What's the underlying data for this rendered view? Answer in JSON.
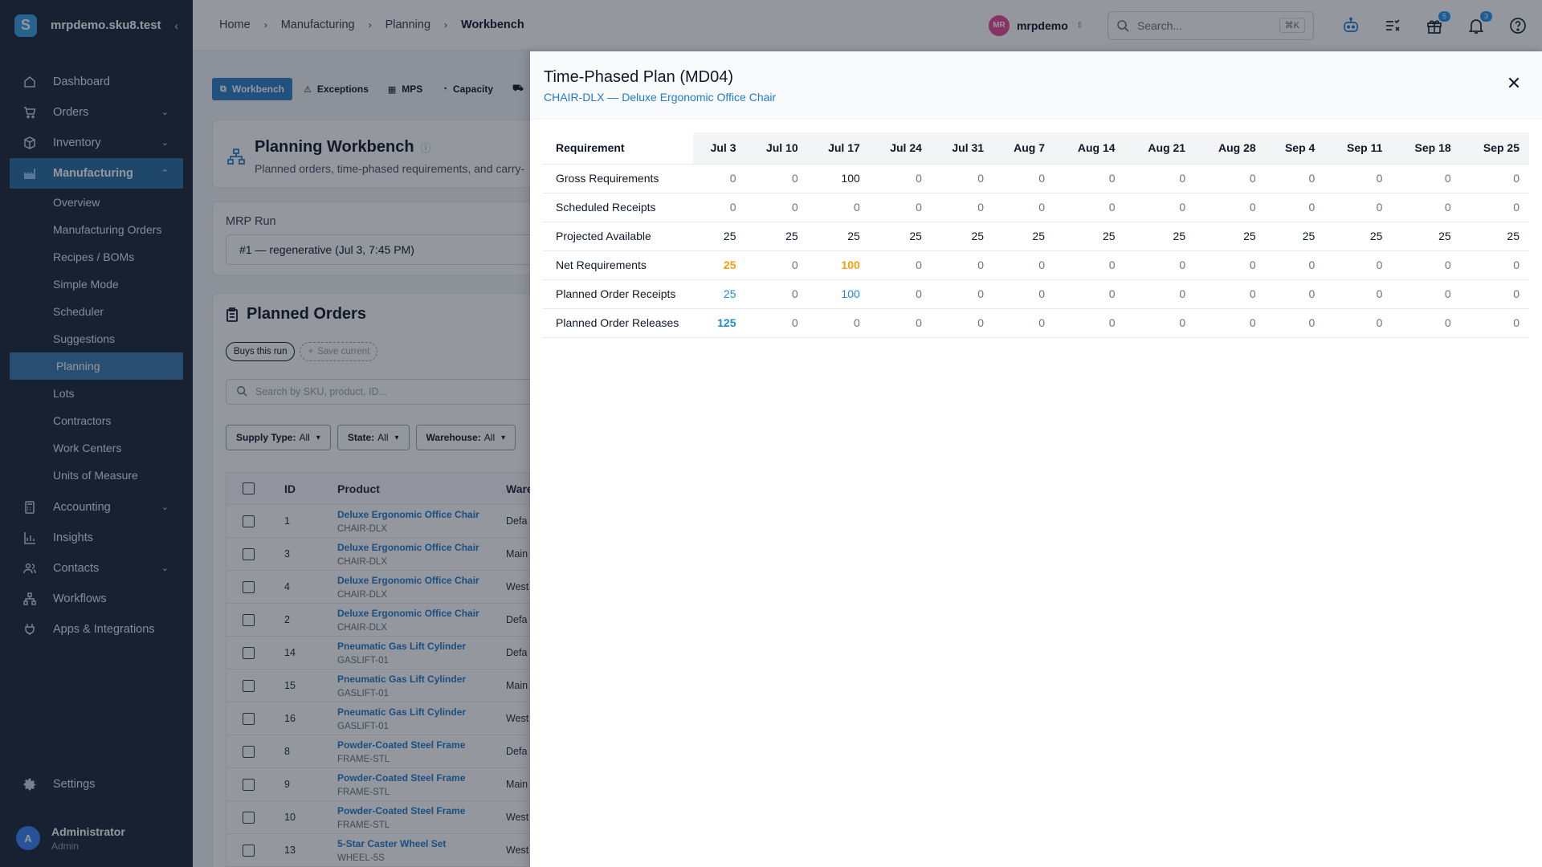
{
  "app": {
    "org_domain": "mrpdemo.sku8.test",
    "logo_letter": "S"
  },
  "sidebar": {
    "items": [
      {
        "label": "Dashboard"
      },
      {
        "label": "Orders"
      },
      {
        "label": "Inventory"
      },
      {
        "label": "Manufacturing"
      },
      {
        "label": "Accounting"
      },
      {
        "label": "Insights"
      },
      {
        "label": "Contacts"
      },
      {
        "label": "Workflows"
      },
      {
        "label": "Apps & Integrations"
      }
    ],
    "manufacturing_sub": [
      {
        "label": "Overview"
      },
      {
        "label": "Manufacturing Orders"
      },
      {
        "label": "Recipes / BOMs"
      },
      {
        "label": "Simple Mode"
      },
      {
        "label": "Scheduler"
      },
      {
        "label": "Suggestions"
      },
      {
        "label": "Planning"
      },
      {
        "label": "Lots"
      },
      {
        "label": "Contractors"
      },
      {
        "label": "Work Centers"
      },
      {
        "label": "Units of Measure"
      }
    ],
    "settings_label": "Settings",
    "user": {
      "initial": "A",
      "name": "Administrator",
      "role": "Admin"
    }
  },
  "topbar": {
    "breadcrumb": [
      "Home",
      "Manufacturing",
      "Planning",
      "Workbench"
    ],
    "org": {
      "initials": "MR",
      "name": "mrpdemo"
    },
    "search": {
      "placeholder": "Search...",
      "shortcut": "⌘K"
    },
    "badges": {
      "gifts": "5",
      "notifications": "3"
    }
  },
  "main": {
    "tabs": [
      "Workbench",
      "Exceptions",
      "MPS",
      "Capacity"
    ],
    "workbench": {
      "title": "Planning Workbench",
      "subtitle": "Planned orders, time-phased requirements, and carry-"
    },
    "mrp_run": {
      "label": "MRP Run",
      "value": "#1 — regenerative (Jul 3, 7:45 PM)"
    },
    "planned_orders": {
      "title": "Planned Orders",
      "chips": [
        "Buys this run",
        "Save current"
      ],
      "search_placeholder": "Search by SKU, product, ID...",
      "filters": [
        {
          "key": "Supply Type:",
          "value": "All"
        },
        {
          "key": "State:",
          "value": "All"
        },
        {
          "key": "Warehouse:",
          "value": "All"
        }
      ],
      "columns": [
        "ID",
        "Product",
        "Ware"
      ],
      "rows": [
        {
          "id": "1",
          "product": "Deluxe Ergonomic Office Chair",
          "sku": "CHAIR-DLX",
          "warehouse": "Defa"
        },
        {
          "id": "3",
          "product": "Deluxe Ergonomic Office Chair",
          "sku": "CHAIR-DLX",
          "warehouse": "Main"
        },
        {
          "id": "4",
          "product": "Deluxe Ergonomic Office Chair",
          "sku": "CHAIR-DLX",
          "warehouse": "West"
        },
        {
          "id": "2",
          "product": "Deluxe Ergonomic Office Chair",
          "sku": "CHAIR-DLX",
          "warehouse": "Defa"
        },
        {
          "id": "14",
          "product": "Pneumatic Gas Lift Cylinder",
          "sku": "GASLIFT-01",
          "warehouse": "Defa"
        },
        {
          "id": "15",
          "product": "Pneumatic Gas Lift Cylinder",
          "sku": "GASLIFT-01",
          "warehouse": "Main"
        },
        {
          "id": "16",
          "product": "Pneumatic Gas Lift Cylinder",
          "sku": "GASLIFT-01",
          "warehouse": "West"
        },
        {
          "id": "8",
          "product": "Powder-Coated Steel Frame",
          "sku": "FRAME-STL",
          "warehouse": "Defa"
        },
        {
          "id": "9",
          "product": "Powder-Coated Steel Frame",
          "sku": "FRAME-STL",
          "warehouse": "Main"
        },
        {
          "id": "10",
          "product": "Powder-Coated Steel Frame",
          "sku": "FRAME-STL",
          "warehouse": "West"
        },
        {
          "id": "13",
          "product": "5-Star Caster Wheel Set",
          "sku": "WHEEL-5S",
          "warehouse": "West"
        }
      ]
    }
  },
  "drawer": {
    "title": "Time-Phased Plan (MD04)",
    "subtitle": "CHAIR-DLX — Deluxe Ergonomic Office Chair",
    "requirement_header": "Requirement",
    "periods": [
      "Jul 3",
      "Jul 10",
      "Jul 17",
      "Jul 24",
      "Jul 31",
      "Aug 7",
      "Aug 14",
      "Aug 21",
      "Aug 28",
      "Sep 4",
      "Sep 11",
      "Sep 18",
      "Sep 25"
    ],
    "rows": [
      {
        "label": "Gross Requirements",
        "values": [
          "0",
          "0",
          "100",
          "0",
          "0",
          "0",
          "0",
          "0",
          "0",
          "0",
          "0",
          "0",
          "0"
        ]
      },
      {
        "label": "Scheduled Receipts",
        "values": [
          "0",
          "0",
          "0",
          "0",
          "0",
          "0",
          "0",
          "0",
          "0",
          "0",
          "0",
          "0",
          "0"
        ]
      },
      {
        "label": "Projected Available",
        "values": [
          "25",
          "25",
          "25",
          "25",
          "25",
          "25",
          "25",
          "25",
          "25",
          "25",
          "25",
          "25",
          "25"
        ]
      },
      {
        "label": "Net Requirements",
        "values": [
          "25",
          "0",
          "100",
          "0",
          "0",
          "0",
          "0",
          "0",
          "0",
          "0",
          "0",
          "0",
          "0"
        ]
      },
      {
        "label": "Planned Order Receipts",
        "values": [
          "25",
          "0",
          "100",
          "0",
          "0",
          "0",
          "0",
          "0",
          "0",
          "0",
          "0",
          "0",
          "0"
        ]
      },
      {
        "label": "Planned Order Releases",
        "values": [
          "125",
          "0",
          "0",
          "0",
          "0",
          "0",
          "0",
          "0",
          "0",
          "0",
          "0",
          "0",
          "0"
        ]
      }
    ]
  },
  "colors": {
    "sidebar_bg": "#1e293b",
    "accent": "#2f80c6",
    "link": "#1f7ccb",
    "warning": "#f59e0b"
  }
}
